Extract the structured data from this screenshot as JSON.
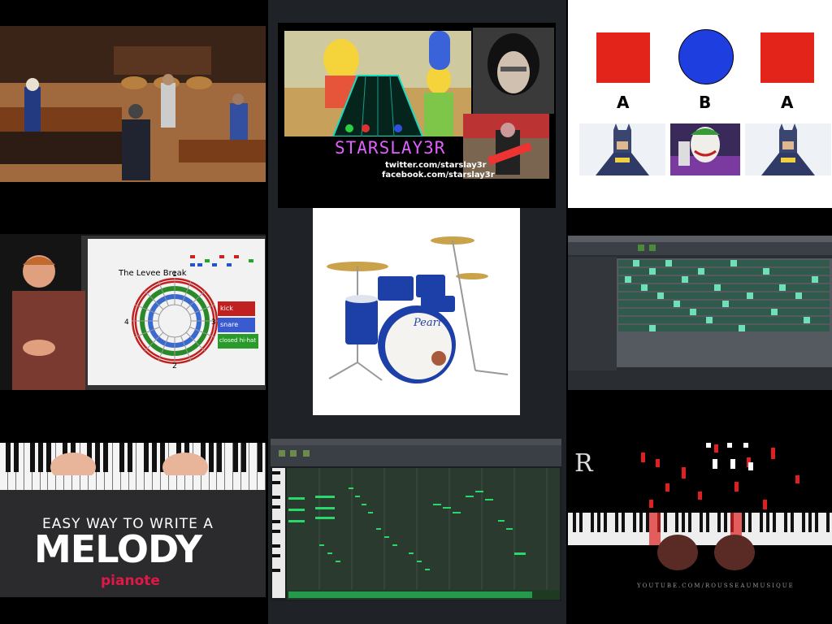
{
  "colors": {
    "page_bg": "#000000",
    "center_col_bg": "#1f2226",
    "red": "#e3241b",
    "blue": "#1f3ee0"
  },
  "tiles": {
    "marimba": {
      "icon": "marimba-ensemble-photo"
    },
    "guitar_hero": {
      "title": "STARSLAY3R",
      "twitter": "twitter.com/starslay3r",
      "facebook": "facebook.com/starslay3r"
    },
    "aba": {
      "labels": [
        "A",
        "B",
        "A"
      ],
      "shapes": [
        "red-square",
        "blue-circle",
        "red-square"
      ],
      "pictures": [
        "batman-icon",
        "joker-icon",
        "batman-icon"
      ]
    },
    "levee": {
      "title": "The Levee Break",
      "ring_numbers": [
        "1",
        "2",
        "3",
        "4"
      ],
      "legend": [
        "kick",
        "snare",
        "closed hi-hat"
      ]
    },
    "drums": {
      "brand": "Pearl"
    },
    "sequencer": {
      "icon": "step-sequencer-screenshot"
    },
    "melody": {
      "line1": "EASY WAY TO WRITE A",
      "line2": "MELODY",
      "brand": "pianote"
    },
    "piano_roll": {
      "icon": "piano-roll-screenshot"
    },
    "synthesia": {
      "letter": "R",
      "footer": "YOUTUBE.COM/ROUSSEAUMUSIQUE"
    }
  }
}
